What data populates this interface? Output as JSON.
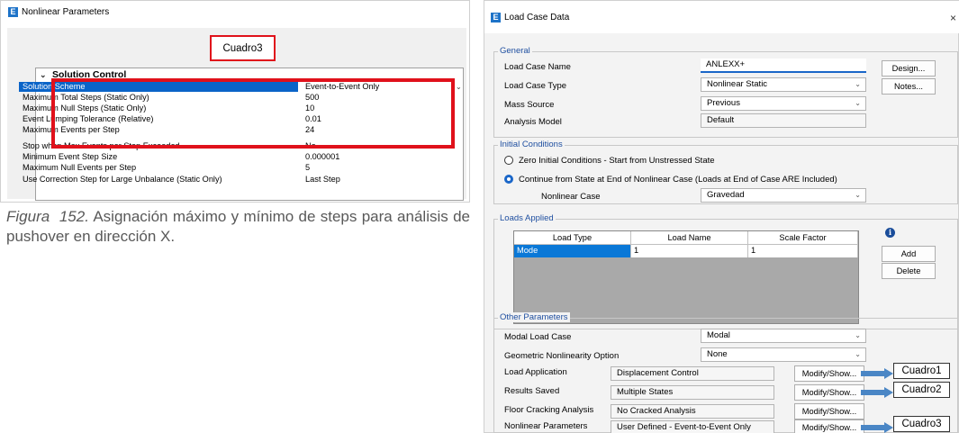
{
  "left_window": {
    "title": "Nonlinear Parameters",
    "callout": "Cuadro3",
    "group_title": "Solution Control",
    "rows": [
      {
        "name": "Solution Scheme",
        "value": "Event-to-Event Only"
      },
      {
        "name": "Maximum Total Steps (Static Only)",
        "value": "500"
      },
      {
        "name": "Maximum Null Steps (Static Only)",
        "value": "10"
      },
      {
        "name": "Event Lumping Tolerance (Relative)",
        "value": "0.01"
      },
      {
        "name": "Maximum Events per Step",
        "value": "24"
      },
      {
        "name": "Stop when Max Events per Step Exceeded",
        "value": "No"
      },
      {
        "name": "Minimum Event Step Size",
        "value": "0.000001"
      },
      {
        "name": "Maximum Null Events per Step",
        "value": "5"
      },
      {
        "name": "Use Correction Step for Large Unbalance (Static Only)",
        "value": "Last Step"
      }
    ]
  },
  "caption": {
    "label": "Figura",
    "number": "152.",
    "text": "Asignación máximo y mínimo de steps para análisis de pushover en dirección X."
  },
  "right_window": {
    "title": "Load Case Data",
    "close": "×",
    "general": {
      "legend": "General",
      "load_case_name_label": "Load Case Name",
      "load_case_name": "ANLEXX+",
      "load_case_type_label": "Load Case Type",
      "load_case_type": "Nonlinear Static",
      "mass_source_label": "Mass Source",
      "mass_source": "Previous",
      "analysis_model_label": "Analysis Model",
      "analysis_model": "Default",
      "design_button": "Design...",
      "notes_button": "Notes..."
    },
    "initial_conditions": {
      "legend": "Initial Conditions",
      "option_zero": "Zero Initial Conditions - Start from Unstressed State",
      "option_continue": "Continue from State at End of Nonlinear Case  (Loads at End of Case ARE Included)",
      "nonlinear_case_label": "Nonlinear Case",
      "nonlinear_case": "Gravedad"
    },
    "loads_applied": {
      "legend": "Loads Applied",
      "headers": [
        "Load Type",
        "Load Name",
        "Scale Factor"
      ],
      "row": [
        "Mode",
        "1",
        "1"
      ],
      "add_button": "Add",
      "delete_button": "Delete"
    },
    "other_parameters": {
      "legend": "Other Parameters",
      "modal_load_case_label": "Modal Load Case",
      "modal_load_case": "Modal",
      "geometric_label": "Geometric Nonlinearity Option",
      "geometric": "None",
      "rows": [
        {
          "label": "Load Application",
          "value": "Displacement Control",
          "button": "Modify/Show...",
          "tag": "Cuadro1"
        },
        {
          "label": "Results Saved",
          "value": "Multiple States",
          "button": "Modify/Show...",
          "tag": "Cuadro2"
        },
        {
          "label": "Floor Cracking Analysis",
          "value": "No Cracked Analysis",
          "button": "Modify/Show...",
          "tag": ""
        },
        {
          "label": "Nonlinear Parameters",
          "value": "User Defined - Event-to-Event Only",
          "button": "Modify/Show...",
          "tag": "Cuadro3"
        }
      ]
    }
  },
  "colors": {
    "highlight_red": "#e0111b",
    "selection_blue": "#0a64c8",
    "arrow_blue": "#4a86c5"
  }
}
